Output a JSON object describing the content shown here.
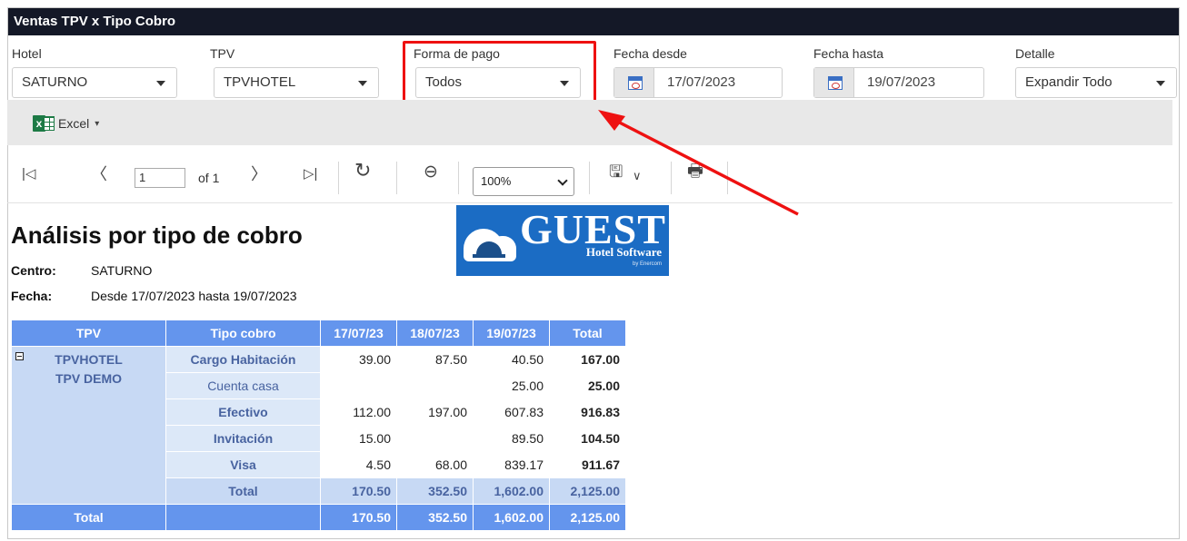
{
  "window": {
    "title": "Ventas TPV x Tipo Cobro"
  },
  "filters": {
    "hotel": {
      "label": "Hotel",
      "value": "SATURNO"
    },
    "tpv": {
      "label": "TPV",
      "value": "TPVHOTEL"
    },
    "forma_pago": {
      "label": "Forma de pago",
      "value": "Todos"
    },
    "fecha_desde": {
      "label": "Fecha desde",
      "value": "17/07/2023"
    },
    "fecha_hasta": {
      "label": "Fecha hasta",
      "value": "19/07/2023"
    },
    "detalle": {
      "label": "Detalle",
      "value": "Expandir Todo"
    }
  },
  "export": {
    "excel_label": "Excel",
    "dropdown_glyph": "▾"
  },
  "toolbar": {
    "first_glyph": "|◁",
    "prev_glyph": "〈",
    "page": "1",
    "of_label": "of 1",
    "next_glyph": "〉",
    "last_glyph": "▷|",
    "refresh_glyph": "↻",
    "back_glyph": "⊖",
    "zoom": "100%",
    "save_glyph": "🖫",
    "save_drop_glyph": "∨",
    "print_glyph": "🖶"
  },
  "report": {
    "title": "Análisis por tipo de cobro",
    "centro_label": "Centro:",
    "centro_value": "SATURNO",
    "fecha_label": "Fecha:",
    "fecha_value": "Desde 17/07/2023 hasta 19/07/2023",
    "logo": {
      "name": "GUEST",
      "subtitle": "Hotel Software",
      "by": "by Enercom"
    },
    "table": {
      "headers": [
        "TPV",
        "Tipo cobro",
        "17/07/23",
        "18/07/23",
        "19/07/23",
        "Total"
      ],
      "tpv_names": [
        "TPVHOTEL",
        "TPV DEMO"
      ],
      "rows": [
        {
          "tipo": "Cargo Habitación",
          "d1": "39.00",
          "d2": "87.50",
          "d3": "40.50",
          "total": "167.00"
        },
        {
          "tipo": "Cuenta casa",
          "d1": "",
          "d2": "",
          "d3": "25.00",
          "total": "25.00"
        },
        {
          "tipo": "Efectivo",
          "d1": "112.00",
          "d2": "197.00",
          "d3": "607.83",
          "total": "916.83"
        },
        {
          "tipo": "Invitación",
          "d1": "15.00",
          "d2": "",
          "d3": "89.50",
          "total": "104.50"
        },
        {
          "tipo": "Visa",
          "d1": "4.50",
          "d2": "68.00",
          "d3": "839.17",
          "total": "911.67"
        }
      ],
      "subtotal": {
        "label": "Total",
        "d1": "170.50",
        "d2": "352.50",
        "d3": "1,602.00",
        "total": "2,125.00"
      },
      "grandtotal": {
        "label": "Total",
        "d1": "170.50",
        "d2": "352.50",
        "d3": "1,602.00",
        "total": "2,125.00"
      }
    }
  },
  "annotation": {
    "highlight_color": "#ee1111"
  }
}
